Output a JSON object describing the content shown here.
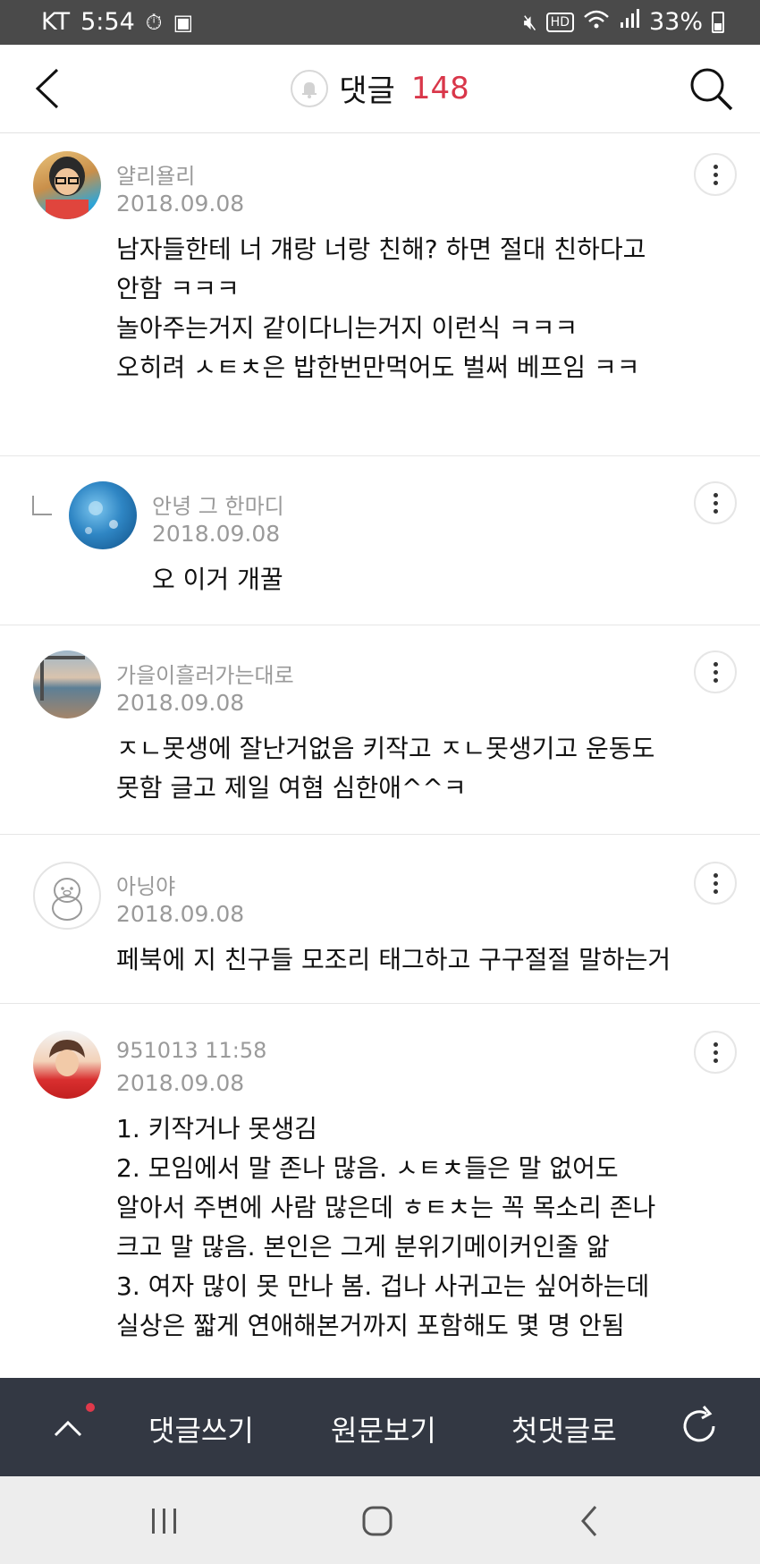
{
  "status_bar": {
    "carrier": "KT",
    "time": "5:54",
    "hd_label": "HD",
    "battery": "33%"
  },
  "header": {
    "title": "댓글",
    "count": "148"
  },
  "comments": [
    {
      "author": "얄리욜리",
      "date": "2018.09.08",
      "lines": [
        "남자들한테 너 걔랑 너랑 친해? 하면 절대 친하다고",
        "안함 ㅋㅋㅋ",
        "놀아주는거지 같이다니는거지 이런식 ㅋㅋㅋ",
        "오히려 ㅅㅌㅊ은 밥한번만먹어도 벌써 베프임 ㅋㅋ"
      ]
    },
    {
      "author": "안녕 그 한마디",
      "date": "2018.09.08",
      "lines": [
        "오 이거 개꿀"
      ]
    },
    {
      "author": "가을이흘러가는대로",
      "date": "2018.09.08",
      "lines": [
        "ㅈㄴ못생에 잘난거없음 키작고 ㅈㄴ못생기고 운동도",
        "못함 글고 제일 여혐 심한애^^ㅋ"
      ]
    },
    {
      "author": "아닝야",
      "date": "2018.09.08",
      "lines": [
        "페북에 지 친구들 모조리 태그하고 구구절절 말하는거"
      ]
    },
    {
      "author": "951013 11:58",
      "date": "2018.09.08",
      "lines": [
        "1. 키작거나 못생김",
        "2. 모임에서 말 존나 많음. ㅅㅌㅊ들은 말 없어도",
        "알아서 주변에 사람 많은데 ㅎㅌㅊ는 꼭 목소리 존나",
        "크고 말 많음. 본인은 그게 분위기메이커인줄 앎",
        "3. 여자 많이 못 만나 봄. 겁나 사귀고는 싶어하는데",
        "실상은 짧게 연애해본거까지 포함해도 몇 명 안됨"
      ]
    }
  ],
  "action_bar": {
    "write": "댓글쓰기",
    "original": "원문보기",
    "first": "첫댓글로"
  }
}
